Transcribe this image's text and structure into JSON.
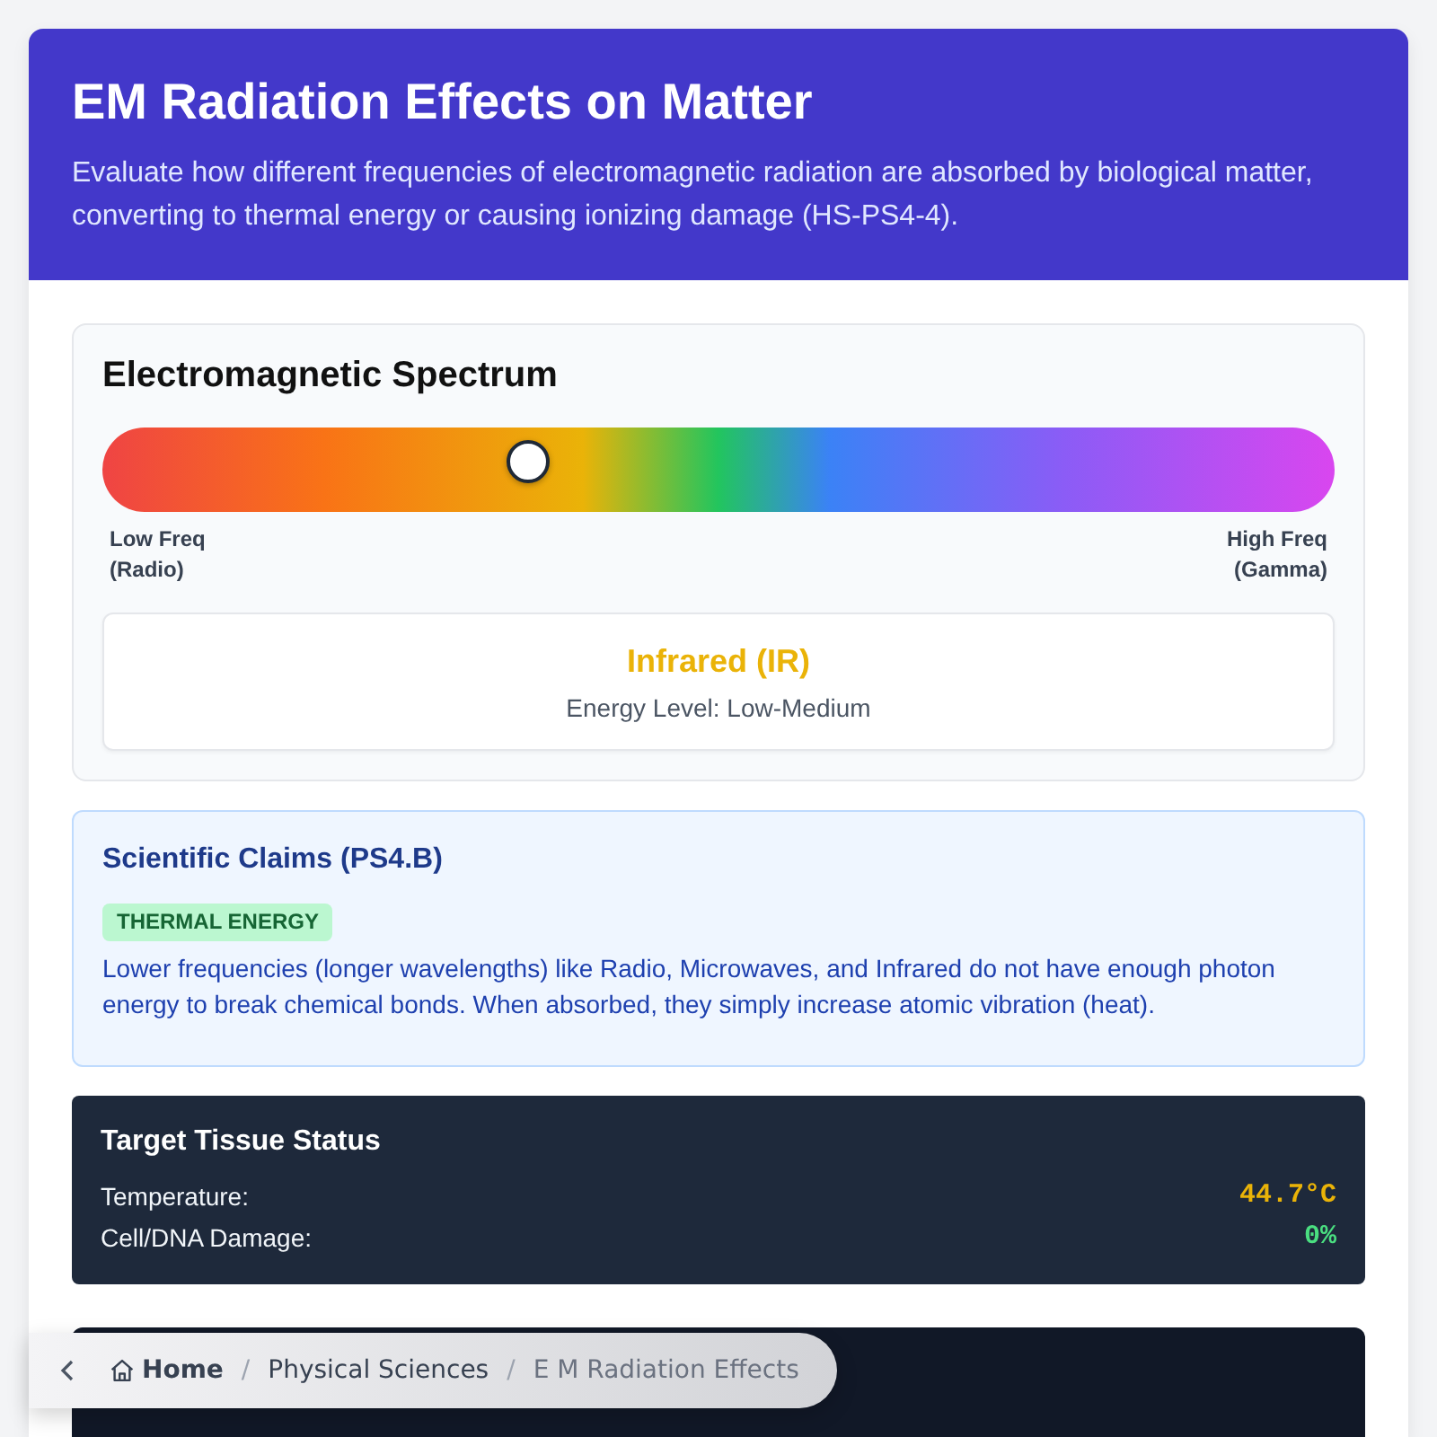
{
  "header": {
    "title": "EM Radiation Effects on Matter",
    "subtitle": "Evaluate how different frequencies of electromagnetic radiation are absorbed by biological matter, converting to thermal energy or causing ionizing damage (HS-PS4-4)."
  },
  "spectrum": {
    "title": "Electromagnetic Spectrum",
    "slider": {
      "level": 0.34
    },
    "low_label": "Low Freq (Radio)",
    "high_label": "High Freq (Gamma)",
    "result": {
      "name": "Infrared (IR)",
      "energy": "Energy Level: Low-Medium"
    }
  },
  "claims": {
    "title": "Scientific Claims (PS4.B)",
    "tag": "THERMAL ENERGY",
    "text": "Lower frequencies (longer wavelengths) like Radio, Microwaves, and Infrared do not have enough photon energy to break chemical bonds. When absorbed, they simply increase atomic vibration (heat)."
  },
  "status": {
    "title": "Target Tissue Status",
    "rows": [
      {
        "label": "Temperature:",
        "value": "44.7°C",
        "color": "#eab308"
      },
      {
        "label": "Cell/DNA Damage:",
        "value": "0%",
        "color": "#4ade80"
      }
    ]
  },
  "breadcrumb": {
    "separator": "/",
    "items": [
      {
        "label": "Home",
        "kind": "home"
      },
      {
        "label": "Physical Sciences",
        "kind": "link"
      },
      {
        "label": "E M Radiation Effects",
        "kind": "current"
      }
    ]
  }
}
